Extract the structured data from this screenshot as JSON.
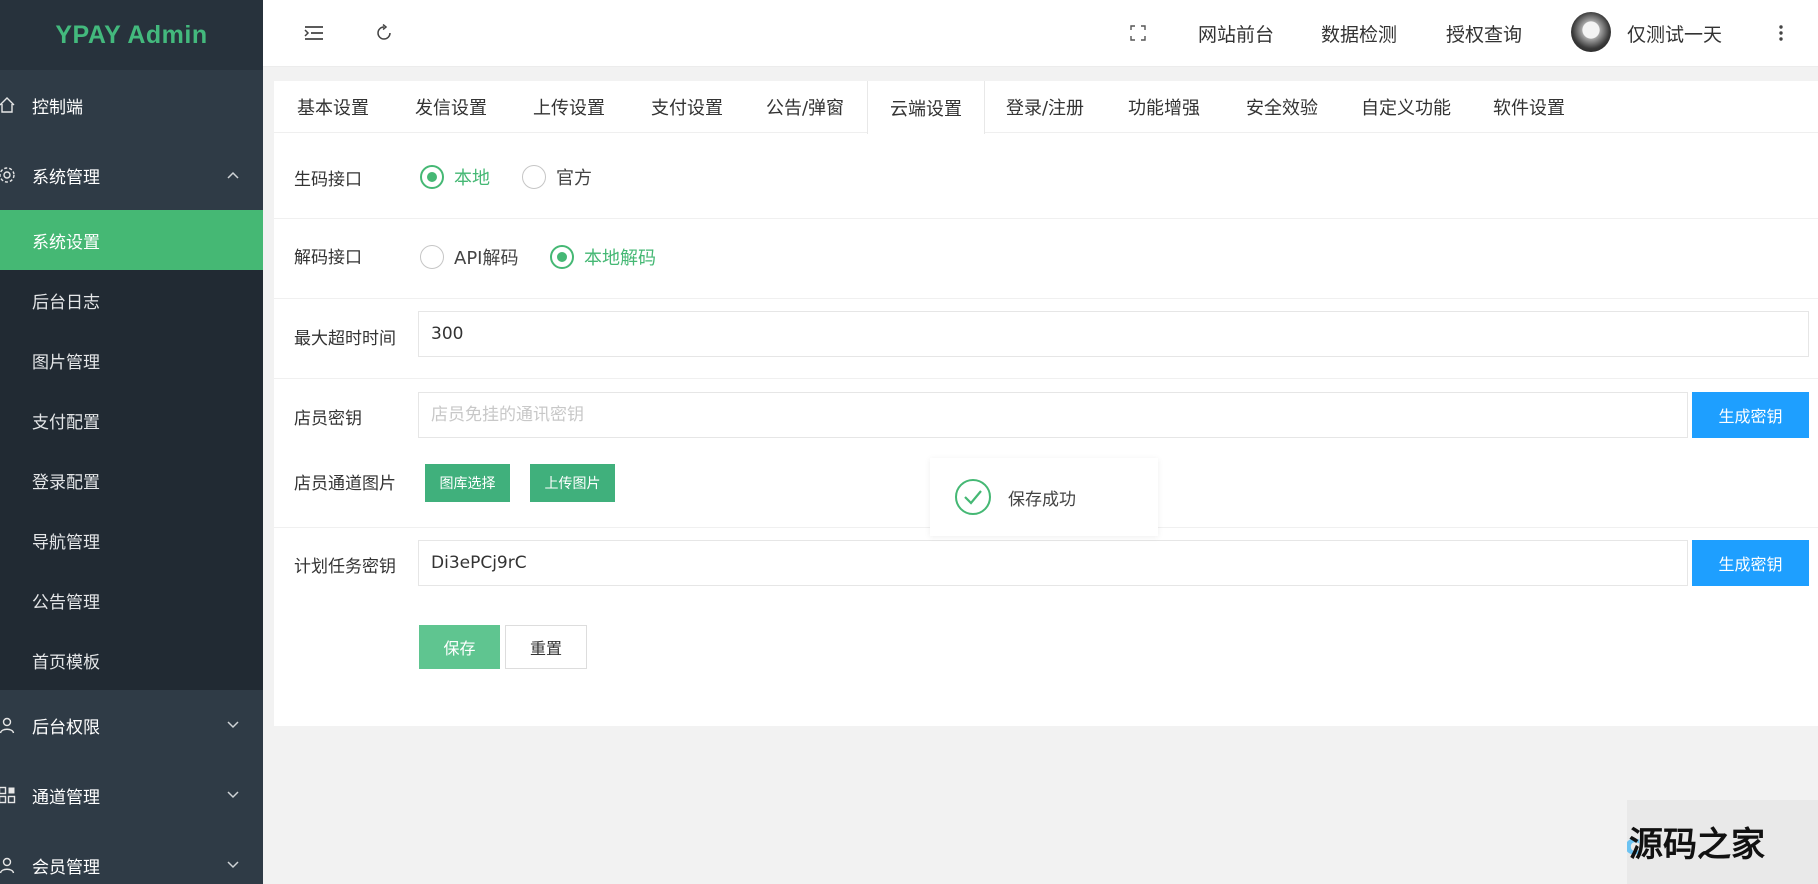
{
  "brand": "YPAY Admin",
  "sidebar": {
    "items": [
      {
        "label": "控制端",
        "icon": "home-icon"
      },
      {
        "label": "系统管理",
        "icon": "gear-icon"
      }
    ],
    "submenu": [
      "系统设置",
      "后台日志",
      "图片管理",
      "支付配置",
      "登录配置",
      "导航管理",
      "公告管理",
      "首页模板"
    ],
    "bottom_items": [
      {
        "label": "后台权限",
        "icon": "user-icon"
      },
      {
        "label": "通道管理",
        "icon": "apps-icon"
      },
      {
        "label": "会员管理",
        "icon": "user-icon"
      }
    ]
  },
  "topbar": {
    "links": [
      "网站前台",
      "数据检测",
      "授权查询"
    ],
    "username": "仅测试一天"
  },
  "tabs": [
    "基本设置",
    "发信设置",
    "上传设置",
    "支付设置",
    "公告/弹窗",
    "云端设置",
    "登录/注册",
    "功能增强",
    "安全效验",
    "自定义功能",
    "软件设置"
  ],
  "active_tab": "云端设置",
  "form": {
    "code_api": {
      "label": "生码接口",
      "options": [
        "本地",
        "官方"
      ],
      "selected": "本地"
    },
    "decode_api": {
      "label": "解码接口",
      "options": [
        "API解码",
        "本地解码"
      ],
      "selected": "本地解码"
    },
    "timeout": {
      "label": "最大超时时间",
      "value": "300"
    },
    "clerk_key": {
      "label": "店员密钥",
      "placeholder": "店员免挂的通讯密钥",
      "button": "生成密钥"
    },
    "clerk_image": {
      "label": "店员通道图片",
      "buttons": [
        "图库选择",
        "上传图片"
      ]
    },
    "cron_key": {
      "label": "计划任务密钥",
      "value": "Di3ePCj9rC",
      "button": "生成密钥"
    },
    "save": "保存",
    "reset": "重置"
  },
  "toast": "保存成功",
  "watermark": "HzKu.c源码之家",
  "colors": {
    "accent": "#45b874",
    "primary_blue": "#1e9fff",
    "sidebar": "#2f3b46"
  }
}
